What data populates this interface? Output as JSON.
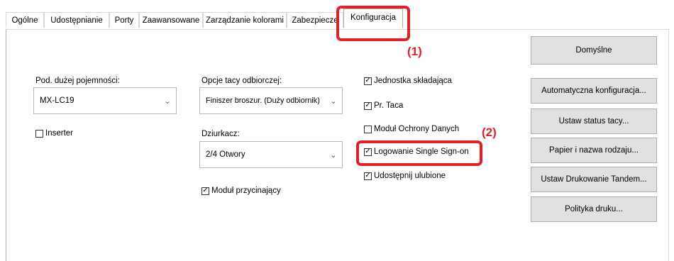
{
  "tabs": [
    {
      "label": "Ogólne"
    },
    {
      "label": "Udostępnianie"
    },
    {
      "label": "Porty"
    },
    {
      "label": "Zaawansowane"
    },
    {
      "label": "Zarządzanie kolorami"
    },
    {
      "label": "Zabezpiecze"
    },
    {
      "label": "Konfiguracja"
    }
  ],
  "callouts": {
    "one": "(1)",
    "two": "(2)"
  },
  "left_col": {
    "high_capacity_label": "Pod. dużej pojemności:",
    "high_capacity_value": "MX-LC19",
    "inserter_label": "Inserter"
  },
  "mid_col": {
    "output_tray_label": "Opcje tacy odbiorczej:",
    "output_tray_value": "Finiszer broszur. (Duży odbiornik)",
    "punch_label": "Dziurkacz:",
    "punch_value": "2/4 Otwory",
    "trimmer_label": "Moduł przycinający"
  },
  "right_col": {
    "folding_unit": "Jednostka składająca",
    "pr_tray": "Pr. Taca",
    "data_security": "Moduł Ochrony Danych",
    "single_sign_on": "Logowanie Single Sign-on",
    "share_favorites": "Udostępnij ulubione"
  },
  "buttons": {
    "default": "Domyślne",
    "auto_config": "Automatyczna konfiguracja...",
    "tray_status": "Ustaw status tacy...",
    "paper_type": "Papier i nazwa rodzaju...",
    "tandem_print": "Ustaw Drukowanie Tandem...",
    "print_policy": "Polityka druku..."
  },
  "colors": {
    "callout_red": "#e0202a",
    "button_bg": "#e1e1e1"
  }
}
